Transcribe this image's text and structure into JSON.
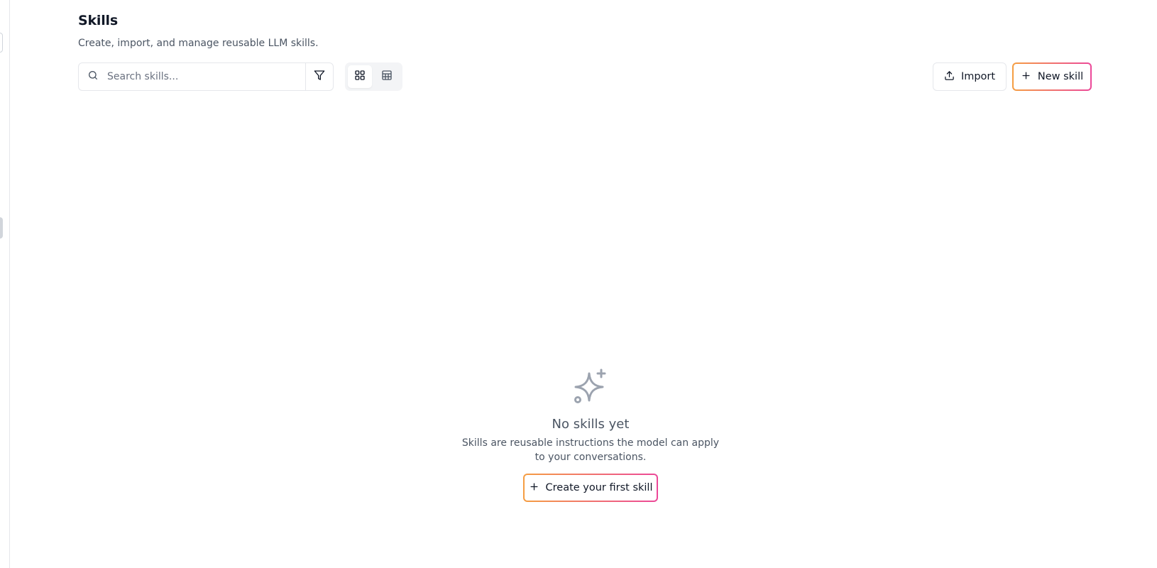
{
  "header": {
    "title": "Skills",
    "subtitle": "Create, import, and manage reusable LLM skills."
  },
  "toolbar": {
    "search_placeholder": "Search skills...",
    "search_value": "",
    "filter_icon": "filter-icon",
    "view_modes": [
      {
        "name": "grid",
        "icon": "grid-icon",
        "active": true
      },
      {
        "name": "table",
        "icon": "table-icon",
        "active": false
      }
    ],
    "import_label": "Import",
    "new_skill_label": "New skill"
  },
  "empty_state": {
    "icon": "sparkles-icon",
    "title": "No skills yet",
    "description": "Skills are reusable instructions the model can apply to your conversations.",
    "cta_label": "Create your first skill"
  },
  "colors": {
    "accent_gradient_start": "#f59e42",
    "accent_gradient_end": "#ec4899",
    "muted_text": "#4b5563",
    "border": "#e5e7eb"
  }
}
